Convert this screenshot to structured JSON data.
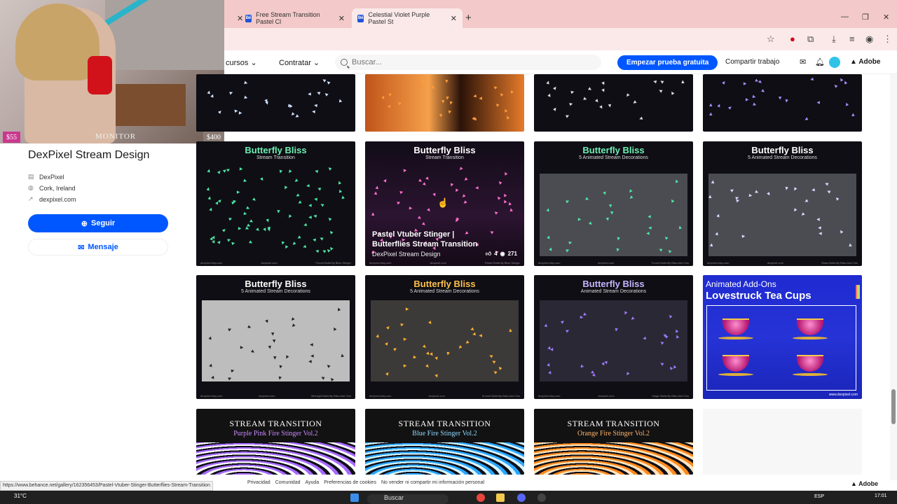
{
  "browser": {
    "tabs": [
      {
        "label": "Free Stream Transition Pastel Cl",
        "active": false
      },
      {
        "label": "Celestial Violet Purple Pastel St",
        "active": true
      }
    ],
    "fav_text": "Bē"
  },
  "header": {
    "nav_cursos": "cursos",
    "nav_contratar": "Contratar",
    "search_placeholder": "Buscar...",
    "cta_label": "Empezar prueba gratuita",
    "share_label": "Compartir trabajo",
    "adobe_label": "Adobe"
  },
  "webcam": {
    "price_left": "$55",
    "price_right": "$400",
    "monitor_label": "MONITOR"
  },
  "profile": {
    "name": "DexPixel Stream Design",
    "owner": "DexPixel",
    "location": "Cork, Ireland",
    "website": "dexpixel.com",
    "follow_label": "Seguir",
    "message_label": "Mensaje"
  },
  "grid": {
    "row2": [
      {
        "title": "Butterfly Bliss",
        "subtitle": "Stream Transition",
        "title_color": "#6ef0b4",
        "accent": "#4fe6a4",
        "footer": "Forest Butterfly Bliss Stinger"
      },
      {
        "title": "Butterfly Bliss",
        "subtitle": "Stream Transition",
        "title_color": "#ffffff",
        "accent": "#ff6fcf",
        "footer": "Pastel Butterfly Bliss Stinger"
      },
      {
        "title": "Butterfly Bliss",
        "subtitle": "5 Animated Stream Decorations",
        "title_color": "#6ef0b4",
        "accent": "#4fe6a4",
        "footer": "Forest Butterfly Bliss Add Ons"
      },
      {
        "title": "Butterfly Bliss",
        "subtitle": "5 Animated Stream Decorations",
        "title_color": "#ffffff",
        "accent": "#d9d9ff",
        "footer": "Glass Butterfly Bliss Add Ons"
      }
    ],
    "row3": [
      {
        "title": "Butterfly Bliss",
        "subtitle": "5 Animated Stream Decorations",
        "title_color": "#ffffff",
        "accent": "#222222",
        "footer": "Midnight Butterfly Bliss Add Ons"
      },
      {
        "title": "Butterfly Bliss",
        "subtitle": "5 Animated Stream Decorations",
        "title_color": "#ffc14d",
        "accent": "#ffb030",
        "footer": "Sunset Butterfly Bliss Add Ons"
      },
      {
        "title": "Butterfly Bliss",
        "subtitle": "Animated Stream Decorations",
        "title_color": "#c7b6ff",
        "accent": "#9f7bff",
        "footer": "Magic Butterfly Bliss Add Ons"
      }
    ],
    "hover": {
      "title_line1": "Pastel Vtuber Stinger |",
      "title_line2": "Butterflies Stream Transition",
      "owner": "DexPixel Stream Design",
      "likes": "4",
      "views": "271"
    },
    "tea": {
      "line1": "Animated Add-Ons",
      "line2": "Lovestruck Tea Cups",
      "site": "www.dexpixel.com"
    },
    "fire": [
      {
        "title": "STREAM TRANSITION",
        "subtitle": "Purple Pink Fire Stinger Vol.2",
        "sub_color": "#c98bff",
        "c1": "#a66bff",
        "c2": "#ffffff"
      },
      {
        "title": "STREAM TRANSITION",
        "subtitle": "Blue Fire Stinger Vol.2",
        "sub_color": "#8fd9ff",
        "c1": "#2aa6ff",
        "c2": "#d8f6ff"
      },
      {
        "title": "STREAM TRANSITION",
        "subtitle": "Orange Fire Stinger Vol.2",
        "sub_color": "#ffb46b",
        "c1": "#ff8a1e",
        "c2": "#ffe7c2"
      }
    ],
    "footer_left": "dexpixel.etsy.com",
    "footer_mid": "dexpixel.com"
  },
  "status": {
    "url": "https://www.behance.net/gallery/162356453/Pastel-Vtuber-Stinger-Butterflies-Stream-Transition",
    "footer_links": [
      "Privacidad",
      "Comunidad",
      "Ayuda",
      "Preferencias de cookies",
      "No vender ni compartir mi información personal"
    ],
    "footer_adobe": "Adobe"
  },
  "taskbar": {
    "temp": "31°C",
    "search_label": "Buscar",
    "lang": "ESP",
    "time": "17:01"
  },
  "colors": {
    "brand": "#0057ff",
    "tab_bg": "#f3c9c9"
  }
}
